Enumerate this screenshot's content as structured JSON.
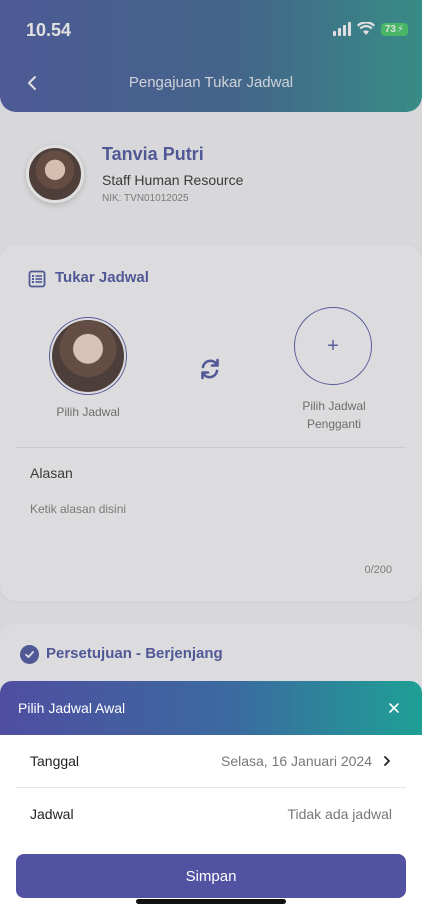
{
  "status_bar": {
    "time": "10.54",
    "battery": "73"
  },
  "header": {
    "title": "Pengajuan Tukar Jadwal"
  },
  "profile": {
    "name": "Tanvia Putri",
    "role": "Staff Human Resource",
    "nik": "NIK: TVN01012025"
  },
  "swap_section": {
    "title": "Tukar Jadwal",
    "left_label": "Pilih Jadwal",
    "right_label_line1": "Pilih Jadwal",
    "right_label_line2": "Pengganti",
    "reason_title": "Alasan",
    "reason_placeholder": "Ketik alasan disini",
    "counter": "0/200"
  },
  "approval_section": {
    "title": "Persetujuan - Berjenjang"
  },
  "sheet": {
    "title": "Pilih Jadwal Awal",
    "rows": [
      {
        "label": "Tanggal",
        "value": "Selasa, 16 Januari 2024"
      },
      {
        "label": "Jadwal",
        "value": "Tidak ada jadwal"
      }
    ],
    "save_label": "Simpan"
  }
}
